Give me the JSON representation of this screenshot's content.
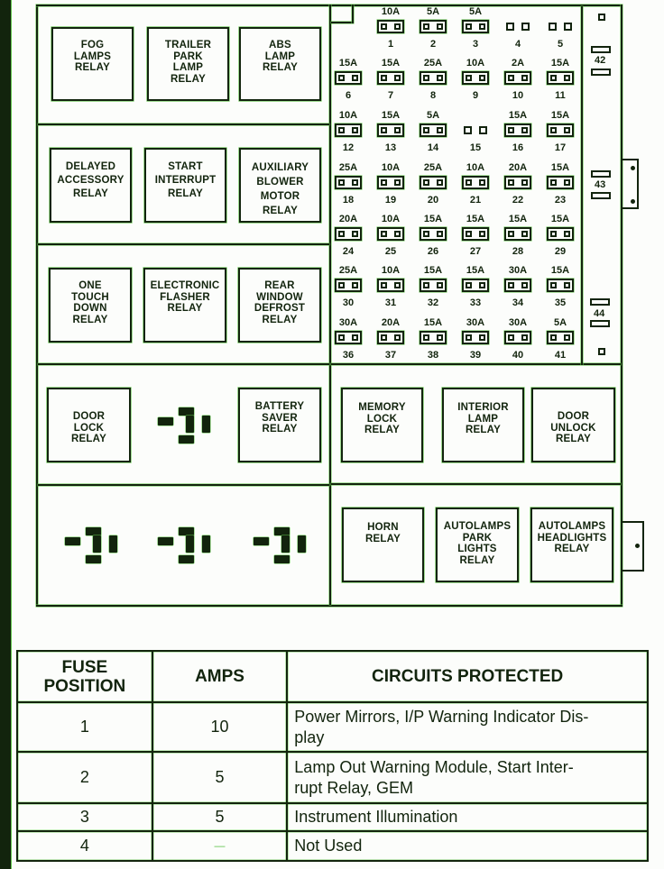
{
  "diagram": {
    "relays": {
      "fog_lamps": "FOG\nLAMPS\nRELAY",
      "trailer_park_lamp": "TRAILER\nPARK\nLAMP\nRELAY",
      "abs_lamp": "ABS\nLAMP\nRELAY",
      "delayed_accessory": "DELAYED\nACCESSORY\nRELAY",
      "start_interrupt": "START\nINTERRUPT\nRELAY",
      "auxiliary_blower_motor": "AUXILIARY\nBLOWER\nMOTOR\nRELAY",
      "one_touch_down": "ONE\nTOUCH\nDOWN\nRELAY",
      "electronic_flasher": "ELECTRONIC\nFLASHER\nRELAY",
      "rear_window_defrost": "REAR\nWINDOW\nDEFROST\nRELAY",
      "door_lock": "DOOR\nLOCK\nRELAY",
      "battery_saver": "BATTERY\nSAVER\nRELAY",
      "memory_lock": "MEMORY\nLOCK\nRELAY",
      "interior_lamp": "INTERIOR\nLAMP\nRELAY",
      "door_unlock": "DOOR\nUNLOCK\nRELAY",
      "horn": "HORN\nRELAY",
      "autolamps_park_lights": "AUTOLAMPS\nPARK\nLIGHTS\nRELAY",
      "autolamps_headlights": "AUTOLAMPS\nHEADLIGHTS\nRELAY"
    },
    "fuses": [
      {
        "num": "1",
        "amp": "10A"
      },
      {
        "num": "2",
        "amp": "5A"
      },
      {
        "num": "3",
        "amp": "5A"
      },
      {
        "num": "4",
        "amp": ""
      },
      {
        "num": "5",
        "amp": ""
      },
      {
        "num": "6",
        "amp": "15A"
      },
      {
        "num": "7",
        "amp": "15A"
      },
      {
        "num": "8",
        "amp": "25A"
      },
      {
        "num": "9",
        "amp": "10A"
      },
      {
        "num": "10",
        "amp": "2A"
      },
      {
        "num": "11",
        "amp": "15A"
      },
      {
        "num": "12",
        "amp": "10A"
      },
      {
        "num": "13",
        "amp": "15A"
      },
      {
        "num": "14",
        "amp": "5A"
      },
      {
        "num": "15",
        "amp": ""
      },
      {
        "num": "16",
        "amp": "15A"
      },
      {
        "num": "17",
        "amp": "15A"
      },
      {
        "num": "18",
        "amp": "25A"
      },
      {
        "num": "19",
        "amp": "10A"
      },
      {
        "num": "20",
        "amp": "25A"
      },
      {
        "num": "21",
        "amp": "10A"
      },
      {
        "num": "22",
        "amp": "20A"
      },
      {
        "num": "23",
        "amp": "15A"
      },
      {
        "num": "24",
        "amp": "20A"
      },
      {
        "num": "25",
        "amp": "10A"
      },
      {
        "num": "26",
        "amp": "15A"
      },
      {
        "num": "27",
        "amp": "15A"
      },
      {
        "num": "28",
        "amp": "15A"
      },
      {
        "num": "29",
        "amp": "15A"
      },
      {
        "num": "30",
        "amp": "25A"
      },
      {
        "num": "31",
        "amp": "10A"
      },
      {
        "num": "32",
        "amp": "15A"
      },
      {
        "num": "33",
        "amp": "15A"
      },
      {
        "num": "34",
        "amp": "30A"
      },
      {
        "num": "35",
        "amp": "15A"
      },
      {
        "num": "36",
        "amp": "30A"
      },
      {
        "num": "37",
        "amp": "20A"
      },
      {
        "num": "38",
        "amp": "15A"
      },
      {
        "num": "39",
        "amp": "30A"
      },
      {
        "num": "40",
        "amp": "30A"
      },
      {
        "num": "41",
        "amp": "5A"
      }
    ],
    "maxi_fuses": [
      "42",
      "43",
      "44"
    ]
  },
  "table": {
    "headers": {
      "position": "FUSE\nPOSITION",
      "amps": "AMPS",
      "circuits": "CIRCUITS PROTECTED"
    },
    "rows": [
      {
        "position": "1",
        "amps": "10",
        "circuits": "Power Mirrors, I/P Warning Indicator Dis-\nplay"
      },
      {
        "position": "2",
        "amps": "5",
        "circuits": "Lamp Out Warning Module, Start Inter-\nrupt Relay, GEM"
      },
      {
        "position": "3",
        "amps": "5",
        "circuits": "Instrument Illumination"
      },
      {
        "position": "4",
        "amps": "—",
        "circuits": "Not Used"
      }
    ]
  },
  "colors": {
    "ink": "#12240d",
    "edge": "#5fc24a",
    "paper": "#fcfdfb"
  }
}
